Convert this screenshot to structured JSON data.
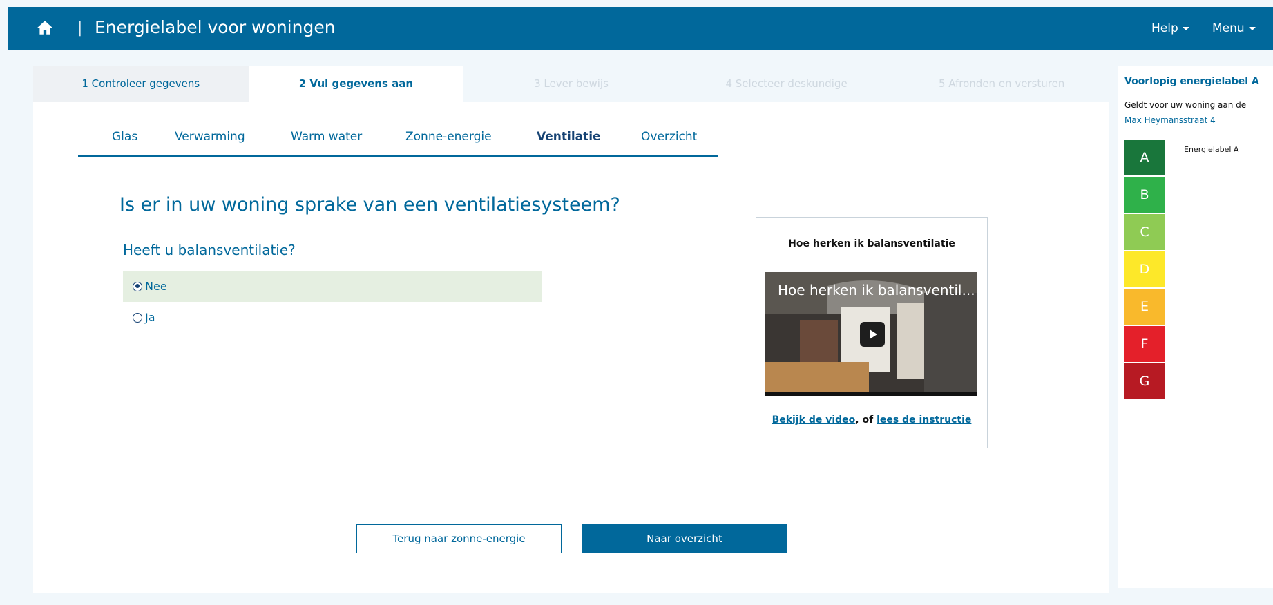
{
  "header": {
    "title": "Energielabel voor woningen",
    "separator": "|",
    "help": "Help",
    "menu": "Menu"
  },
  "steps": [
    {
      "label": "1 Controleer gegevens",
      "state": "done"
    },
    {
      "label": "2 Vul gegevens aan",
      "state": "active"
    },
    {
      "label": "3 Lever bewijs",
      "state": "disabled"
    },
    {
      "label": "4 Selecteer deskundige",
      "state": "disabled"
    },
    {
      "label": "5 Afronden en versturen",
      "state": "disabled"
    }
  ],
  "subtabs": [
    {
      "label": "Glas"
    },
    {
      "label": "Verwarming"
    },
    {
      "label": "Warm water"
    },
    {
      "label": "Zonne-energie"
    },
    {
      "label": "Ventilatie",
      "active": true
    },
    {
      "label": "Overzicht"
    }
  ],
  "form": {
    "question": "Is er in uw woning sprake van een ventilatiesysteem?",
    "sub_question": "Heeft u balansventilatie?",
    "options": [
      {
        "label": "Nee",
        "selected": true
      },
      {
        "label": "Ja",
        "selected": false
      }
    ]
  },
  "video": {
    "title": "Hoe herken ik balansventilatie",
    "caption": "Hoe herken ik balansventil...",
    "link_video": "Bekijk de video",
    "separator": ", of",
    "link_instruction": "lees de instructie"
  },
  "buttons": {
    "back": "Terug naar zonne-energie",
    "next": "Naar overzicht"
  },
  "sidebar": {
    "title": "Voorlopig energielabel A",
    "line": "Geldt voor uw woning aan de",
    "address": "Max Heymansstraat 4",
    "current_label": "Energielabel A",
    "labels": [
      {
        "letter": "A",
        "color": "#19763b"
      },
      {
        "letter": "B",
        "color": "#2fb14a"
      },
      {
        "letter": "C",
        "color": "#8fcb54"
      },
      {
        "letter": "D",
        "color": "#fde829"
      },
      {
        "letter": "E",
        "color": "#f9b92c"
      },
      {
        "letter": "F",
        "color": "#e4202a"
      },
      {
        "letter": "G",
        "color": "#b71a23"
      }
    ]
  },
  "colors": {
    "brand": "#01689b",
    "selected_option": "#e5efe1"
  }
}
